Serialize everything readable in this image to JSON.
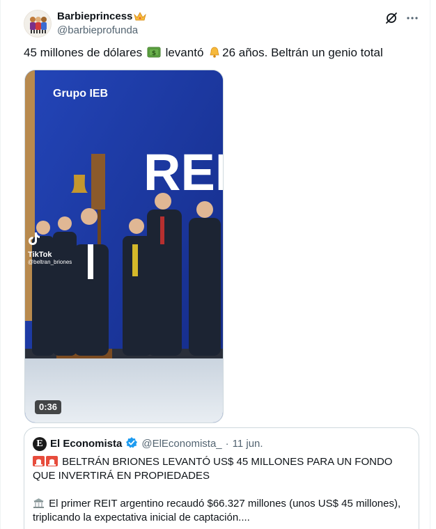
{
  "author": {
    "display_name": "Barbieprincess",
    "handle": "@barbieprofunda"
  },
  "tweet": {
    "text_part1": "45 millones de dólares",
    "text_part2": "levantó",
    "text_part3": "26 años. Beltrán un genio total"
  },
  "media": {
    "duration": "0:36",
    "watermark_brand": "TikTok",
    "watermark_handle": "@beltran_briones",
    "banner_logo": "Grupo IEB",
    "banner_sign": "REI"
  },
  "quote": {
    "display_name": "El Economista",
    "avatar_letter": "E",
    "handle": "@ElEconomista_",
    "separator": "·",
    "date": "11 jun.",
    "headline": "BELTRÁN BRIONES LEVANTÓ US$ 45 MILLONES PARA UN FONDO QUE INVERTIRÁ EN PROPIEDADES",
    "body": "El primer REIT argentino recaudó $66.327 millones (unos US$ 45 millones), triplicando la expectativa inicial de captación...."
  },
  "icons": {
    "verified": "verified-badge-icon",
    "grok": "grok-icon",
    "more": "more-icon",
    "money": "money-emoji-icon",
    "bell": "bell-emoji-icon",
    "siren": "siren-emoji-icon",
    "building": "building-emoji-icon"
  },
  "colors": {
    "text": "#0f1419",
    "secondary": "#536471",
    "verified": "#1d9bf0",
    "border": "#cfd9de",
    "banner_blue": "#1d3ba8"
  }
}
